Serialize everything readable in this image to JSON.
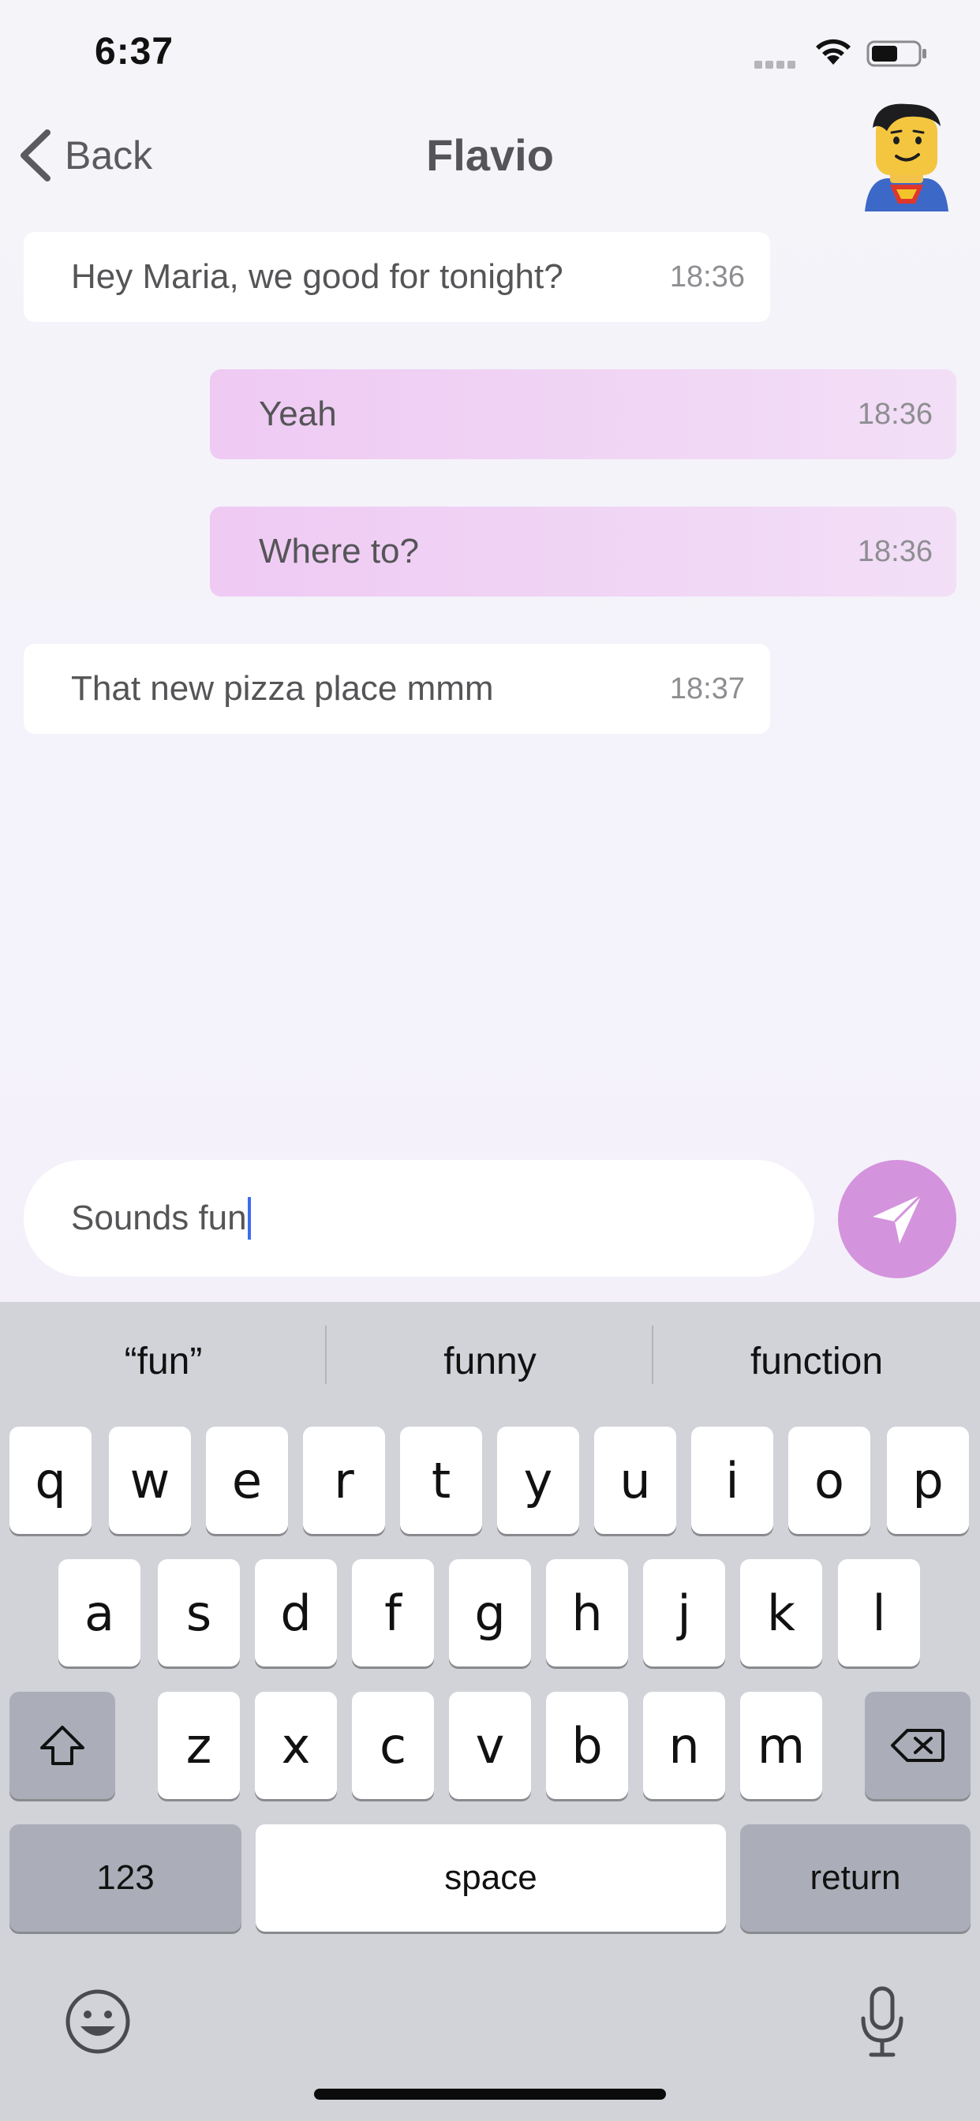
{
  "status_bar": {
    "time": "6:37"
  },
  "nav": {
    "back_label": "Back",
    "title": "Flavio"
  },
  "messages": [
    {
      "direction": "incoming",
      "text": "Hey Maria, we good for tonight?",
      "time": "18:36"
    },
    {
      "direction": "outgoing",
      "text": "Yeah",
      "time": "18:36"
    },
    {
      "direction": "outgoing",
      "text": "Where to?",
      "time": "18:36"
    },
    {
      "direction": "incoming",
      "text": "That new pizza place mmm",
      "time": "18:37"
    }
  ],
  "composer": {
    "value": "Sounds fun"
  },
  "keyboard": {
    "suggestions": [
      "“fun”",
      "funny",
      "function"
    ],
    "row1": [
      "q",
      "w",
      "e",
      "r",
      "t",
      "y",
      "u",
      "i",
      "o",
      "p"
    ],
    "row2": [
      "a",
      "s",
      "d",
      "f",
      "g",
      "h",
      "j",
      "k",
      "l"
    ],
    "row3": [
      "z",
      "x",
      "c",
      "v",
      "b",
      "n",
      "m"
    ],
    "numbers_label": "123",
    "space_label": "space",
    "return_label": "return"
  },
  "colors": {
    "outgoing_bubble": "#efcaf3",
    "incoming_bubble": "#ffffff",
    "send_button": "#d493dd",
    "caret": "#3c6df0",
    "keyboard_bg": "#d1d3d9"
  },
  "icons": [
    "chevron-left-icon",
    "avatar",
    "send-icon",
    "shift-icon",
    "backspace-icon",
    "emoji-icon",
    "microphone-icon",
    "wifi-icon",
    "battery-icon"
  ]
}
